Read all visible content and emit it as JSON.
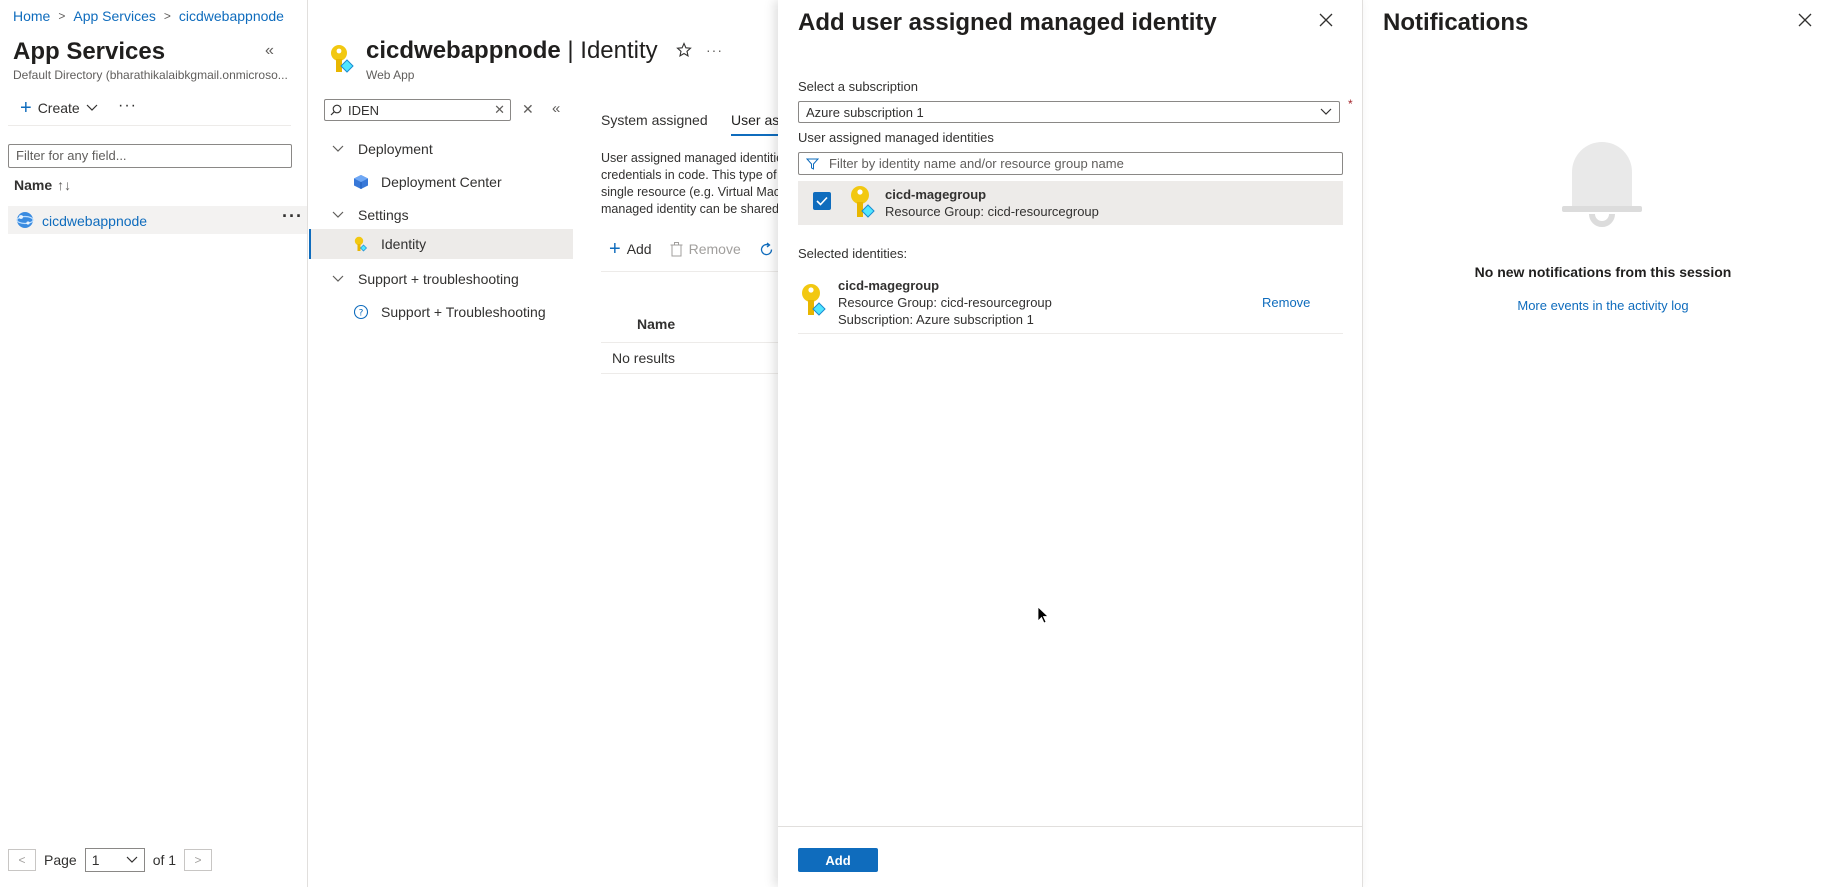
{
  "breadcrumb": [
    "Home",
    "App Services",
    "cicdwebappnode"
  ],
  "left_pane": {
    "title": "App Services",
    "subtitle": "Default Directory (bharathikalaibkgmail.onmicroso...",
    "create_label": "Create",
    "filter_placeholder": "Filter for any field...",
    "name_column": "Name",
    "sort_indicator": "↑↓",
    "resource_name": "cicdwebappnode",
    "pager": {
      "prev": "<",
      "page_label": "Page",
      "page_value": "1",
      "of_label": "of 1",
      "next": ">"
    }
  },
  "resource": {
    "name": "cicdwebappnode",
    "separator": " | ",
    "section": "Identity",
    "type": "Web App"
  },
  "menu": {
    "search_value": "IDEN",
    "items": [
      {
        "label": "Deployment",
        "kind": "group"
      },
      {
        "label": "Deployment Center",
        "kind": "child",
        "icon": "cube-icon"
      },
      {
        "label": "Settings",
        "kind": "group"
      },
      {
        "label": "Identity",
        "kind": "child",
        "icon": "key-icon",
        "selected": true
      },
      {
        "label": "Support + troubleshooting",
        "kind": "group"
      },
      {
        "label": "Support + Troubleshooting",
        "kind": "child",
        "icon": "help-icon"
      }
    ]
  },
  "identity_page": {
    "tabs": [
      "System assigned",
      "User assigned"
    ],
    "description_lines": [
      "User assigned managed identities enable Azure resources to authenticate to cloud services (e.g. Azure Key Vault) without storing",
      "credentials in code. This type of managed identities are created as standalone Azure resources, and have their own lifecycle. A",
      "single resource (e.g. Virtual Machine) can utilize multiple user assigned managed identities. Similarly, a single user assigned",
      "managed identity can be shared across multiple resources (e.g. Virtual Machine)."
    ],
    "toolbar": {
      "add": "Add",
      "remove": "Remove"
    },
    "column_name": "Name",
    "empty_text": "No results"
  },
  "blade": {
    "title": "Add user assigned managed identity",
    "subscription_label": "Select a subscription",
    "subscription_value": "Azure subscription 1",
    "required_mark": "*",
    "uami_label": "User assigned managed identities",
    "filter_placeholder": "Filter by identity name and/or resource group name",
    "identity": {
      "name": "cicd-magegroup",
      "resource_group": "Resource Group: cicd-resourcegroup",
      "checked": true
    },
    "selected_label": "Selected identities:",
    "selected": {
      "name": "cicd-magegroup",
      "resource_group": "Resource Group: cicd-resourcegroup",
      "subscription": "Subscription: Azure subscription 1",
      "remove": "Remove"
    },
    "add_button": "Add"
  },
  "notifications": {
    "title": "Notifications",
    "empty_text": "No new notifications from this session",
    "link": "More events in the activity log"
  },
  "colors": {
    "accent": "#0f6cbd",
    "key_gold": "#f2c811",
    "selected_row": "#edebe9"
  }
}
